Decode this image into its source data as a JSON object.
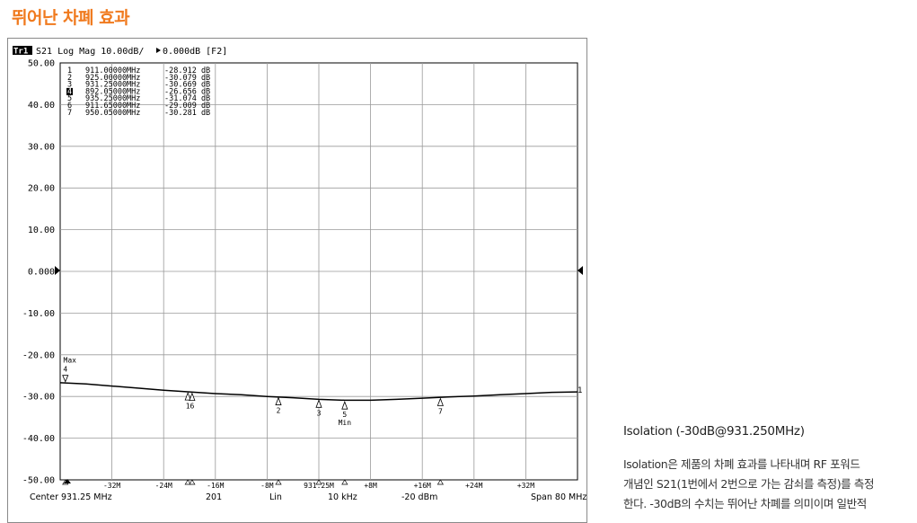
{
  "page_title": "뛰어난 차폐 효과",
  "side_panel": {
    "heading": "Isolation (-30dB@931.250MHz)",
    "body_lines": [
      "Isolation은 제품의 차폐 효과를 나타내며 RF 포워드",
      "개념인 S21(1번에서 2번으로 가는 감쇠를 측정)를 측정",
      "한다. -30dB의 수치는 뛰어난 차폐를 의미이며 일반적"
    ]
  },
  "analyzer": {
    "header": {
      "trace_tag": "Tr1",
      "params": "S21 Log Mag 10.00dB/",
      "ref_value": "0.000dB [F2]"
    },
    "footer": {
      "center": "Center  931.25 MHz",
      "points": "201",
      "sweep": "Lin",
      "ifbw": "10 kHz",
      "power": "-20 dBm",
      "span": "Span  80 MHz"
    },
    "trace_end_label": "1"
  },
  "chart_data": {
    "type": "line",
    "title": "",
    "xlabel": "",
    "ylabel": "",
    "x_unit": "MHz offset from center",
    "xlim": [
      -40,
      40
    ],
    "ylim": [
      -50,
      50
    ],
    "y_ticks": [
      "50.00",
      "40.00",
      "30.00",
      "20.00",
      "10.00",
      "0.000",
      "-10.00",
      "-20.00",
      "-30.00",
      "-40.00",
      "-50.00"
    ],
    "x_ticks": [
      {
        "x": -32,
        "label": "-32M"
      },
      {
        "x": -24,
        "label": "-24M"
      },
      {
        "x": -16,
        "label": "-16M"
      },
      {
        "x": -8,
        "label": "-8M"
      },
      {
        "x": 0,
        "label": "931.25M"
      },
      {
        "x": 8,
        "label": "+8M"
      },
      {
        "x": 16,
        "label": "+16M"
      },
      {
        "x": 24,
        "label": "+24M"
      },
      {
        "x": 32,
        "label": "+32M"
      }
    ],
    "grid": true,
    "reference_level": 0,
    "series": [
      {
        "color": "#000000",
        "x": [
          -40,
          -36,
          -32,
          -28,
          -24,
          -20,
          -16,
          -12,
          -8,
          -4,
          0,
          4,
          8,
          12,
          16,
          20,
          24,
          28,
          32,
          36,
          40
        ],
        "values": [
          -26.7,
          -27.0,
          -27.5,
          -28.0,
          -28.5,
          -28.9,
          -29.3,
          -29.6,
          -30.0,
          -30.3,
          -30.7,
          -30.9,
          -30.9,
          -30.7,
          -30.4,
          -30.1,
          -29.9,
          -29.6,
          -29.3,
          -29.0,
          -28.9
        ]
      }
    ],
    "markers": [
      {
        "id": "1",
        "freq": "911.00000MHz",
        "value": "-28.912 dB",
        "x": -20.25,
        "y": -28.912
      },
      {
        "id": "2",
        "freq": "925.00000MHz",
        "value": "-30.079 dB",
        "x": -6.25,
        "y": -30.079
      },
      {
        "id": "3",
        "freq": "931.25000MHz",
        "value": "-30.669 dB",
        "x": 0,
        "y": -30.669
      },
      {
        "id": "4",
        "freq": "892.05000MHz",
        "value": "-26.656 dB",
        "x": -39.2,
        "y": -26.656,
        "active": true,
        "note": "Max"
      },
      {
        "id": "5",
        "freq": "935.25000MHz",
        "value": "-31.074 dB",
        "x": 4,
        "y": -31.074,
        "note": "Min"
      },
      {
        "id": "6",
        "freq": "911.65000MHz",
        "value": "-29.009 dB",
        "x": -19.6,
        "y": -29.009
      },
      {
        "id": "7",
        "freq": "950.05000MHz",
        "value": "-30.281 dB",
        "x": 18.8,
        "y": -30.281
      }
    ]
  }
}
